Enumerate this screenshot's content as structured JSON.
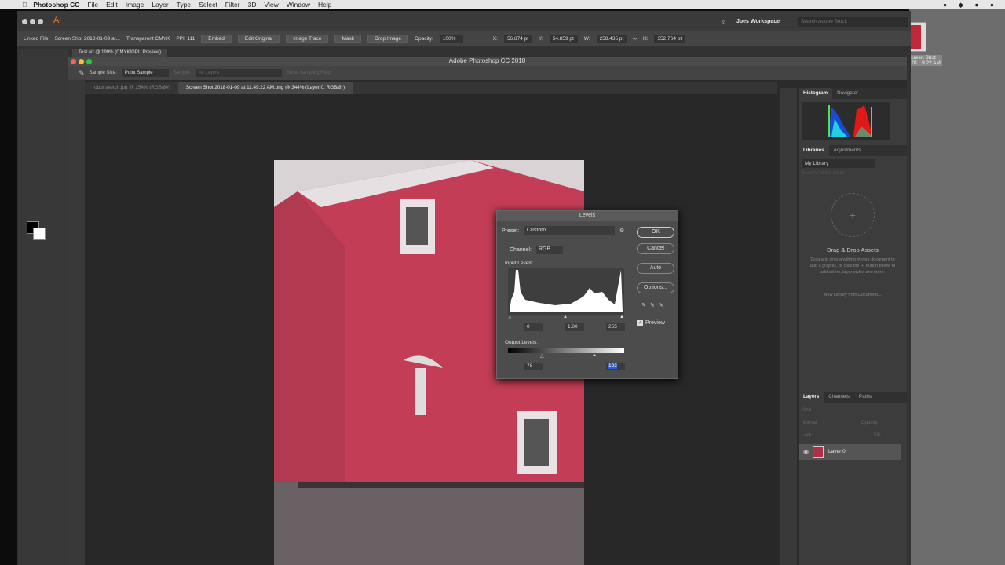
{
  "menubar": {
    "app": "Photoshop CC",
    "items": [
      "File",
      "Edit",
      "Image",
      "Layer",
      "Type",
      "Select",
      "Filter",
      "3D",
      "View",
      "Window",
      "Help"
    ]
  },
  "illustrator": {
    "logo": "Ai",
    "workspace": "Joes Workspace",
    "search_placeholder": "Search Adobe Stock",
    "control": {
      "linked_file": "Linked File",
      "file_name": "Screen Shot 2018-01-09 at...",
      "color_mode": "Transparent CMYK",
      "ppi": "PPI: 111",
      "embed": "Embed",
      "edit_original": "Edit Original",
      "image_trace": "Image Trace",
      "mask": "Mask",
      "crop_image": "Crop Image",
      "opacity_label": "Opacity:",
      "opacity": "100%",
      "x_label": "X:",
      "x": "56.874 pt",
      "y_label": "Y:",
      "y": "54.859 pt",
      "w_label": "W:",
      "w": "258.435 pt",
      "h_label": "H:",
      "h": "352.764 pt"
    },
    "doc_tab": "Test.ai* @ 199% (CMYK/GPU Preview)"
  },
  "desktop": {
    "file_label_1": "Screen Shot",
    "file_label_2": "...01...9.22 AM"
  },
  "photoshop": {
    "title": "Adobe Photoshop CC 2018",
    "options": {
      "sample_size_label": "Sample Size:",
      "sample_size": "Point Sample",
      "sample_label": "Sample:",
      "sample": "All Layers",
      "show_ring": "Show Sampling Ring"
    },
    "tabs": [
      {
        "label": "robot sketch.jpg @ 254% (RGB/8#)",
        "active": false
      },
      {
        "label": "Screen Shot 2018-01-09 at 11.49.22 AM.png @ 344% (Layer 0, RGB/8*)",
        "active": true
      }
    ],
    "panels": {
      "histogram_tabs": [
        "Histogram",
        "Navigator"
      ],
      "library_tabs": [
        "Libraries",
        "Adjustments"
      ],
      "library": "My Library",
      "library_search": "Search Adobe Stock",
      "drag_title": "Drag & Drop Assets",
      "drag_desc": "Drag and drop anything in your document to add a graphic, or click the '+' button below to add colors, layer styles and more.",
      "new_library": "New Library from Document...",
      "layer_tabs": [
        "Layers",
        "Channels",
        "Paths"
      ],
      "kind": "Kind",
      "blend": "Normal",
      "opacity_label": "Opacity:",
      "lock_label": "Lock:",
      "fill_label": "Fill:",
      "layer_name": "Layer 0"
    }
  },
  "levels": {
    "title": "Levels",
    "preset_label": "Preset:",
    "preset": "Custom",
    "channel_label": "Channel:",
    "channel": "RGB",
    "input_label": "Input Levels:",
    "input_black": "0",
    "input_gamma": "1.00",
    "input_white": "255",
    "output_label": "Output Levels:",
    "output_black": "78",
    "output_white": "193",
    "ok": "OK",
    "cancel": "Cancel",
    "auto": "Auto",
    "options": "Options...",
    "preview": "Preview",
    "preview_checked": true
  }
}
